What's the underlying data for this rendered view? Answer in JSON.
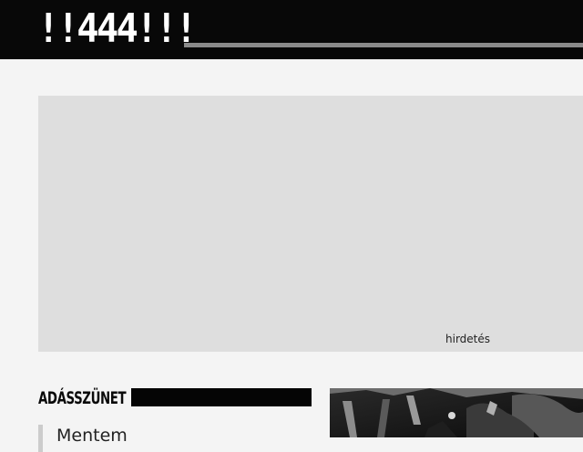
{
  "header": {
    "logo_text": "!!444!!!"
  },
  "ad": {
    "label": "hirdetés"
  },
  "section": {
    "title": "ADÁSSZÜNET",
    "first_item": "Mentem"
  }
}
